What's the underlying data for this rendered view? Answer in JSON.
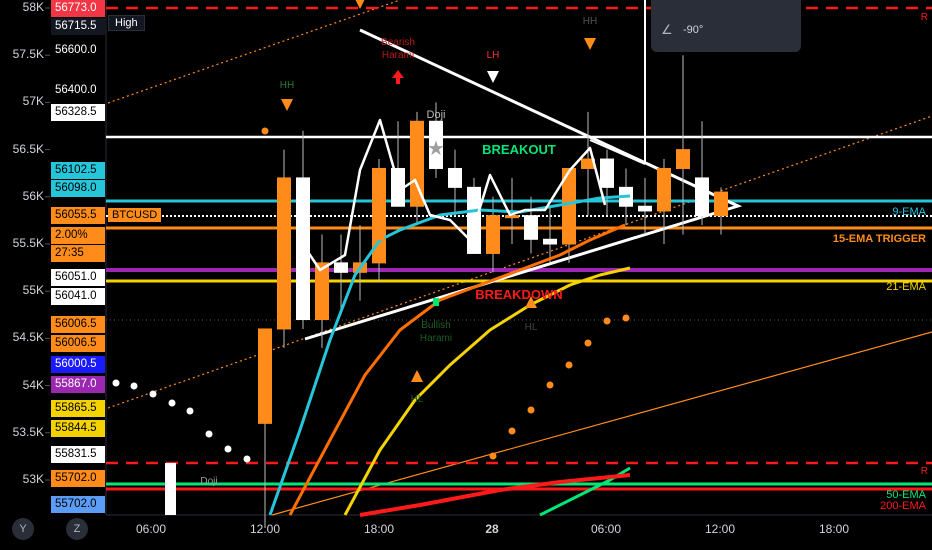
{
  "chart_data": {
    "type": "candlestick",
    "symbol": "BTCUSD",
    "y_ticks": [
      "58K",
      "57.5K",
      "57K",
      "56.5K",
      "56K",
      "55.5K",
      "55K",
      "54.5K",
      "54K",
      "53.5K",
      "53K"
    ],
    "x_ticks": [
      "06:00",
      "12:00",
      "18:00",
      "28",
      "06:00",
      "12:00",
      "18:00"
    ],
    "price_labels": [
      {
        "text": "56773.0",
        "bg": "#f23645",
        "fg": "#fff",
        "v": 58000
      },
      {
        "text": "56715.5",
        "bg": "#131722",
        "fg": "#fff",
        "v": 57810
      },
      {
        "text": "56600.0",
        "bg": "#000",
        "fg": "#fff",
        "v": 57560
      },
      {
        "text": "56400.0",
        "bg": "#000",
        "fg": "#fff",
        "v": 57130
      },
      {
        "text": "56328.5",
        "bg": "#ffffff",
        "fg": "#000",
        "v": 56900
      },
      {
        "text": "56102.5",
        "bg": "#26c6da",
        "fg": "#000",
        "v": 56280
      },
      {
        "text": "56098.0",
        "bg": "#26c6da",
        "fg": "#000",
        "v": 56090
      },
      {
        "text": "56055.5",
        "bg": "#ff8c1a",
        "fg": "#000",
        "v": 55810
      },
      {
        "text": "2.00%",
        "bg": "#ff8c1a",
        "fg": "#000",
        "v": 55600
      },
      {
        "text": "27:35",
        "bg": "#ff8c1a",
        "fg": "#000",
        "v": 55400
      },
      {
        "text": "56051.0",
        "bg": "#ffffff",
        "fg": "#000",
        "v": 55150
      },
      {
        "text": "56041.0",
        "bg": "#ffffff",
        "fg": "#000",
        "v": 54950
      },
      {
        "text": "56006.5",
        "bg": "#ff8c1a",
        "fg": "#000",
        "v": 54650
      },
      {
        "text": "56006.5",
        "bg": "#ff8c1a",
        "fg": "#000",
        "v": 54450
      },
      {
        "text": "56000.5",
        "bg": "#1a1aff",
        "fg": "#fff",
        "v": 54230
      },
      {
        "text": "55867.0",
        "bg": "#9c27b0",
        "fg": "#fff",
        "v": 54020
      },
      {
        "text": "55865.5",
        "bg": "#f5d300",
        "fg": "#000",
        "v": 53760
      },
      {
        "text": "55844.5",
        "bg": "#f5d300",
        "fg": "#000",
        "v": 53550
      },
      {
        "text": "55831.5",
        "bg": "#ffffff",
        "fg": "#000",
        "v": 53280
      },
      {
        "text": "55702.0",
        "bg": "#ff8c1a",
        "fg": "#000",
        "v": 53020
      },
      {
        "text": "55702.0",
        "bg": "#5b9cf6",
        "fg": "#000",
        "v": 52750
      }
    ],
    "high_tag": "High",
    "symbol_tag": "BTCUSD",
    "annotations": [
      "Bearish Harami",
      "LH",
      "HH",
      "HH",
      "Doji",
      "BREAKOUT",
      "BREAKDOWN",
      "Bullish Harami",
      "HL",
      "HL",
      "HL",
      "Doji"
    ],
    "ema_labels": [
      "9-EMA",
      "15-EMA TRIGGER",
      "21-EMA",
      "50-EMA",
      "200-EMA"
    ],
    "level_marks": [
      "R",
      "R"
    ],
    "tooltip_text": "-90°",
    "candles": [
      {
        "o": 53600,
        "h": 54000,
        "l": 52500,
        "c": 54600
      },
      {
        "o": 54600,
        "h": 56500,
        "l": 54400,
        "c": 56200
      },
      {
        "o": 56200,
        "h": 56700,
        "l": 54600,
        "c": 54700
      },
      {
        "o": 54700,
        "h": 55600,
        "l": 54400,
        "c": 55300
      },
      {
        "o": 55300,
        "h": 55600,
        "l": 54800,
        "c": 55200
      },
      {
        "o": 55200,
        "h": 55700,
        "l": 54900,
        "c": 55300
      },
      {
        "o": 55300,
        "h": 56400,
        "l": 55100,
        "c": 56300
      },
      {
        "o": 56300,
        "h": 56800,
        "l": 56000,
        "c": 55900
      },
      {
        "o": 55900,
        "h": 56900,
        "l": 55700,
        "c": 56800
      },
      {
        "o": 56800,
        "h": 57000,
        "l": 56200,
        "c": 56300
      },
      {
        "o": 56300,
        "h": 56500,
        "l": 55800,
        "c": 56100
      },
      {
        "o": 56100,
        "h": 56200,
        "l": 55400,
        "c": 55400
      },
      {
        "o": 55400,
        "h": 56000,
        "l": 55200,
        "c": 55800
      },
      {
        "o": 55800,
        "h": 56200,
        "l": 55500,
        "c": 55800
      },
      {
        "o": 55800,
        "h": 56000,
        "l": 55400,
        "c": 55550
      },
      {
        "o": 55550,
        "h": 55900,
        "l": 55300,
        "c": 55500
      },
      {
        "o": 55500,
        "h": 56200,
        "l": 55300,
        "c": 56300
      },
      {
        "o": 56300,
        "h": 56900,
        "l": 55800,
        "c": 56400
      },
      {
        "o": 56400,
        "h": 56500,
        "l": 55800,
        "c": 56100
      },
      {
        "o": 56100,
        "h": 56300,
        "l": 55700,
        "c": 55900
      },
      {
        "o": 55900,
        "h": 56200,
        "l": 55600,
        "c": 55850
      },
      {
        "o": 55850,
        "h": 56400,
        "l": 55500,
        "c": 56300
      },
      {
        "o": 56300,
        "h": 57500,
        "l": 55600,
        "c": 56500
      },
      {
        "o": 56200,
        "h": 56800,
        "l": 55700,
        "c": 55800
      },
      {
        "o": 55800,
        "h": 56100,
        "l": 55600,
        "c": 56050
      }
    ]
  },
  "ui": {
    "axis_buttons": [
      "Y",
      "Z"
    ],
    "colors": {
      "bg": "#000000",
      "up": "#ff8c1a",
      "ema9": "#26c6da",
      "ema15": "#ff6f00",
      "ema21": "#f5d300",
      "ema50": "#00e676",
      "ema200": "#ff1a1a",
      "purple": "#9c27b0"
    }
  }
}
